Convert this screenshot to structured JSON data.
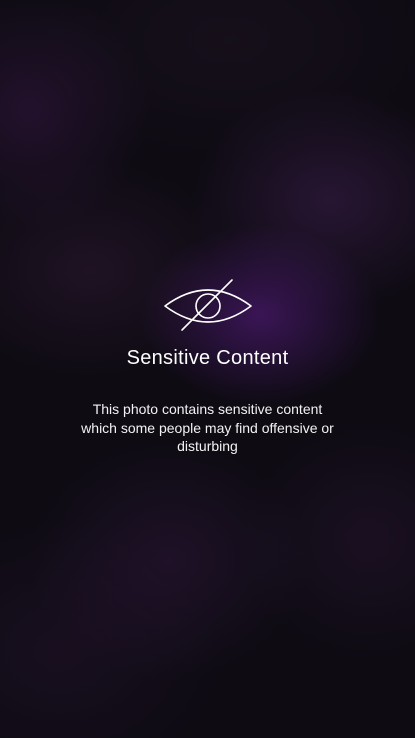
{
  "overlay": {
    "icon": "eye-slash-icon",
    "title": "Sensitive Content",
    "message": "This photo contains sensitive content which some people may find offensive or disturbing"
  }
}
